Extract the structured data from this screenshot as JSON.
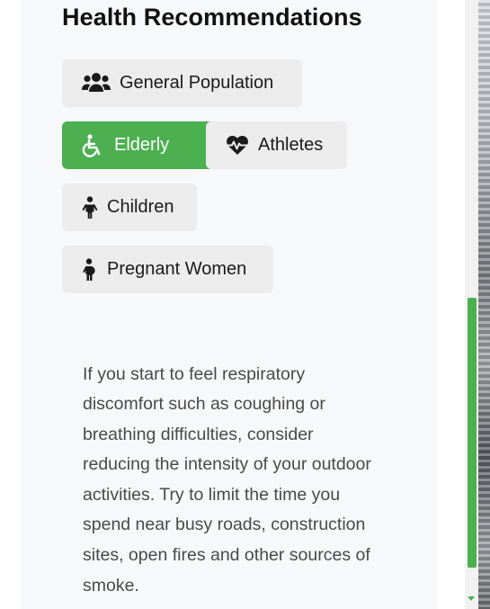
{
  "section_title": "Health Recommendations",
  "groups": [
    {
      "label": "General Population",
      "icon": "users-icon",
      "active": false
    },
    {
      "label": "Elderly",
      "icon": "wheelchair-icon",
      "active": true
    },
    {
      "label": "Athletes",
      "icon": "heartbeat-icon",
      "active": false
    },
    {
      "label": "Children",
      "icon": "child-icon",
      "active": false
    },
    {
      "label": "Pregnant Women",
      "icon": "pregnant-woman-icon",
      "active": false
    }
  ],
  "advice_text": "If you start to feel respiratory discomfort such as coughing or breathing difficulties, consider reducing the intensity of your outdoor activities. Try to limit the time you spend near busy roads, construction sites, open fires and other sources of smoke.",
  "colors": {
    "accent": "#4caf50",
    "chip_bg": "#ececec",
    "panel_bg": "#f7f8fa"
  }
}
